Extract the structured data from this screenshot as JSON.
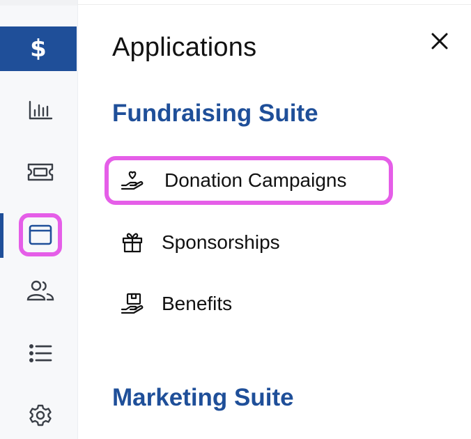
{
  "sidebar": {
    "brand_glyph": "$",
    "items": [
      {
        "name": "analytics",
        "icon": "bar-chart-icon"
      },
      {
        "name": "tickets",
        "icon": "ticket-icon"
      },
      {
        "name": "applications",
        "icon": "browser-window-icon",
        "active": true
      },
      {
        "name": "contacts",
        "icon": "users-icon"
      },
      {
        "name": "lists",
        "icon": "list-icon"
      },
      {
        "name": "settings",
        "icon": "gear-icon"
      }
    ]
  },
  "panel": {
    "title": "Applications",
    "close_icon": "close-icon",
    "suites": [
      {
        "title": "Fundraising Suite",
        "apps": [
          {
            "label": "Donation Campaigns",
            "icon": "hand-heart-icon",
            "highlighted": true
          },
          {
            "label": "Sponsorships",
            "icon": "gift-icon"
          },
          {
            "label": "Benefits",
            "icon": "hand-box-icon"
          }
        ]
      },
      {
        "title": "Marketing Suite",
        "apps": []
      }
    ]
  },
  "colors": {
    "brand": "#1f4f99",
    "highlight": "#e55ee8",
    "rail_bg": "#f7f8fa",
    "icon": "#3a3f47"
  }
}
